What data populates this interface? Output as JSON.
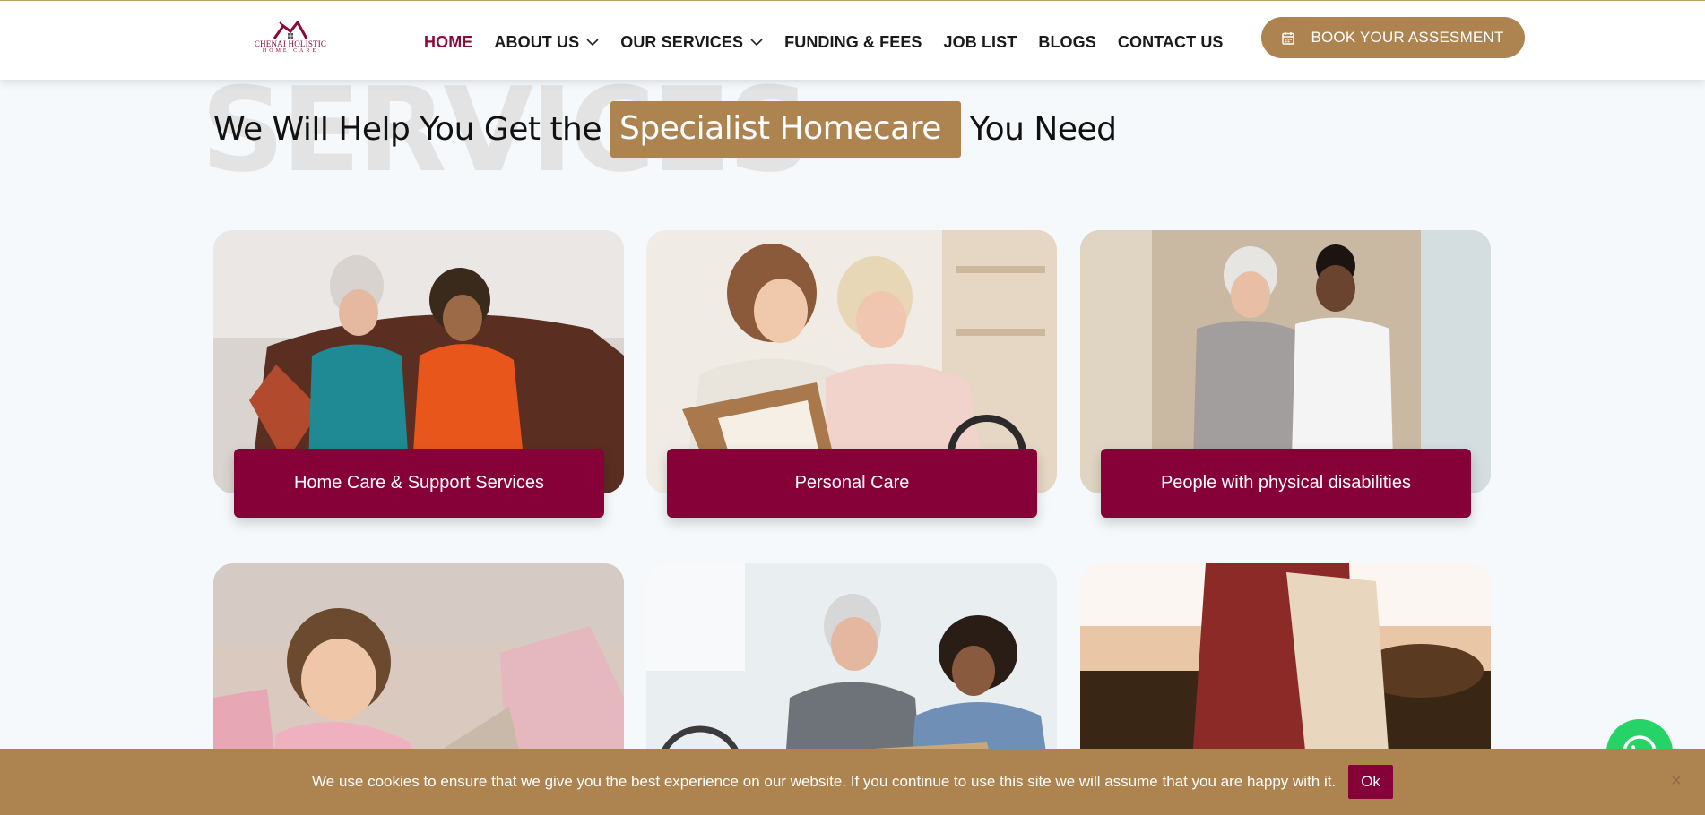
{
  "header": {
    "logo": {
      "name": "CHENAI HOLISTIC",
      "tagline": "HOME CARE",
      "icon": "house-roof-logo-icon"
    },
    "nav": [
      {
        "label": "HOME",
        "active": true,
        "dropdown": false
      },
      {
        "label": "ABOUT US",
        "active": false,
        "dropdown": true
      },
      {
        "label": "OUR SERVICES",
        "active": false,
        "dropdown": true
      },
      {
        "label": "FUNDING & FEES",
        "active": false,
        "dropdown": false
      },
      {
        "label": "JOB LIST",
        "active": false,
        "dropdown": false
      },
      {
        "label": "BLOGS",
        "active": false,
        "dropdown": false
      },
      {
        "label": "CONTACT US",
        "active": false,
        "dropdown": false
      }
    ],
    "cta": {
      "label": "BOOK YOUR ASSESMENT",
      "icon": "calendar-icon"
    }
  },
  "hero": {
    "background_word": "SERVICES",
    "heading_before": "We Will Help You Get the",
    "heading_highlight": "Specialist Homecare",
    "heading_after": "You Need"
  },
  "services": [
    {
      "label": "Home Care & Support Services",
      "image": "two women laughing on brown sofa"
    },
    {
      "label": "Personal Care",
      "image": "young woman reading book with elderly woman"
    },
    {
      "label": "People with physical disabilities",
      "image": "carer walking with elderly woman"
    },
    {
      "label": "",
      "image": "smiling child with laptop on sofa"
    },
    {
      "label": "",
      "image": "elderly man in wheelchair with carer"
    },
    {
      "label": "",
      "image": "pregnant woman outdoors at sunset"
    }
  ],
  "cookie_bar": {
    "text": "We use cookies to ensure that we give you the best experience on our website. If you continue to use this site we will assume that you are happy with it.",
    "ok_label": "Ok",
    "close_label": "×"
  },
  "floating": {
    "icon": "whatsapp-icon"
  },
  "colors": {
    "brand": "#870139",
    "accent": "#ad8350",
    "background": "#f5f9fb"
  }
}
